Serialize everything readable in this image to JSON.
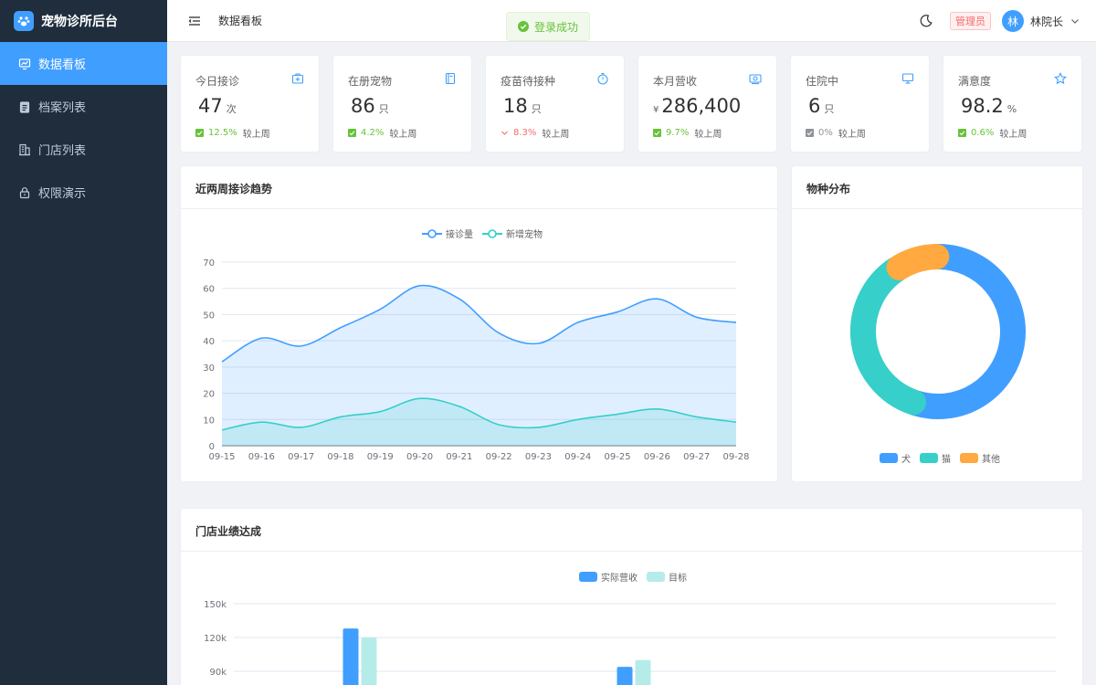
{
  "app": {
    "title": "宠物诊所后台"
  },
  "sidebar": {
    "items": [
      {
        "label": "数据看板",
        "icon": "dashboard-icon",
        "active": true
      },
      {
        "label": "档案列表",
        "icon": "clipboard-icon",
        "active": false
      },
      {
        "label": "门店列表",
        "icon": "building-icon",
        "active": false
      },
      {
        "label": "权限演示",
        "icon": "lock-icon",
        "active": false
      }
    ]
  },
  "header": {
    "page_title": "数据看板",
    "role": "管理员",
    "avatar_initial": "林",
    "user_name": "林院长"
  },
  "toast": {
    "message": "登录成功"
  },
  "stats": [
    {
      "label": "今日接诊",
      "value": "47",
      "prefix": "",
      "unit": "次",
      "change": "12.5%",
      "direction": "up",
      "note": "较上周",
      "icon": "medical-box-icon"
    },
    {
      "label": "在册宠物",
      "value": "86",
      "prefix": "",
      "unit": "只",
      "change": "4.2%",
      "direction": "up",
      "note": "较上周",
      "icon": "notebook-icon"
    },
    {
      "label": "疫苗待接种",
      "value": "18",
      "prefix": "",
      "unit": "只",
      "change": "8.3%",
      "direction": "down",
      "note": "较上周",
      "icon": "stopwatch-icon"
    },
    {
      "label": "本月营收",
      "value": "286,400",
      "prefix": "¥",
      "unit": "",
      "change": "9.7%",
      "direction": "up",
      "note": "较上周",
      "icon": "money-icon"
    },
    {
      "label": "住院中",
      "value": "6",
      "prefix": "",
      "unit": "只",
      "change": "0%",
      "direction": "flat",
      "note": "较上周",
      "icon": "monitor-icon"
    },
    {
      "label": "满意度",
      "value": "98.2",
      "prefix": "",
      "unit": "%",
      "change": "0.6%",
      "direction": "up",
      "note": "较上周",
      "icon": "star-icon"
    }
  ],
  "trend_panel": {
    "title": "近两周接诊趋势"
  },
  "species_panel": {
    "title": "物种分布"
  },
  "store_panel": {
    "title": "门店业绩达成"
  },
  "colors": {
    "primary": "#409eff",
    "teal": "#36cfc9",
    "orange": "#ffa940",
    "success": "#67c23a",
    "danger": "#f56c6c",
    "sidebar_bg": "#1f2d3d"
  },
  "chart_data": [
    {
      "type": "area",
      "x": [
        "09-15",
        "09-16",
        "09-17",
        "09-18",
        "09-19",
        "09-20",
        "09-21",
        "09-22",
        "09-23",
        "09-24",
        "09-25",
        "09-26",
        "09-27",
        "09-28"
      ],
      "series": [
        {
          "name": "接诊量",
          "values": [
            32,
            41,
            38,
            45,
            52,
            61,
            56,
            43,
            39,
            47,
            51,
            56,
            49,
            47
          ],
          "color": "#409eff"
        },
        {
          "name": "新增宠物",
          "values": [
            6,
            9,
            7,
            11,
            13,
            18,
            15,
            8,
            7,
            10,
            12,
            14,
            11,
            9
          ],
          "color": "#36cfc9"
        }
      ],
      "ylim": [
        0,
        70
      ],
      "yticks": [
        0,
        10,
        20,
        30,
        40,
        50,
        60,
        70
      ],
      "grid": true,
      "legend": "top-center"
    },
    {
      "type": "pie",
      "donut": true,
      "categories": [
        "犬",
        "猫",
        "其他"
      ],
      "values": [
        55,
        36,
        9
      ],
      "colors": [
        "#409eff",
        "#36cfc9",
        "#ffa940"
      ],
      "legend": "bottom-center"
    },
    {
      "type": "bar",
      "series": [
        {
          "name": "实际营收",
          "values": [
            128000,
            94000
          ],
          "color": "#409eff"
        },
        {
          "name": "目标",
          "values": [
            120000,
            100000
          ],
          "color": "#b5ece9"
        }
      ],
      "yticks": [
        "150k",
        "120k",
        "90k"
      ],
      "ylim": [
        0,
        150000
      ],
      "grid": true,
      "legend": "top-center"
    }
  ]
}
